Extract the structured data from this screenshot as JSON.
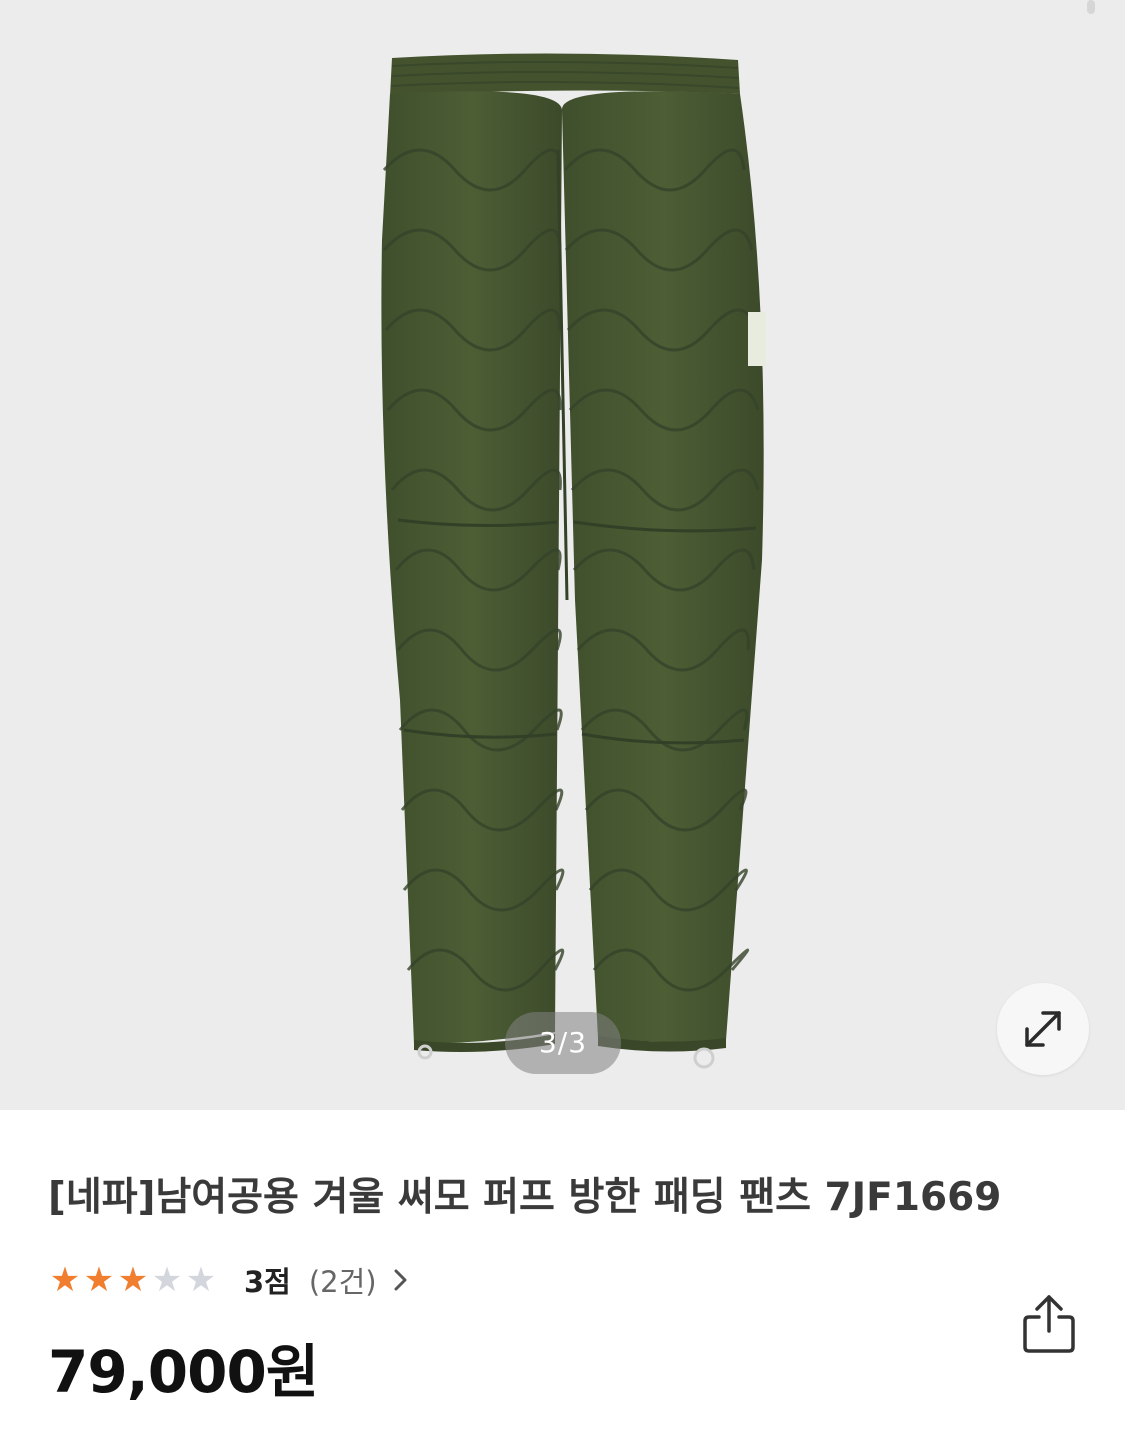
{
  "gallery": {
    "page_indicator": "3/3",
    "image_icon": "quilted-olive-pants-image",
    "expand_icon": "expand-arrows-icon",
    "background_color": "#ececec",
    "product_color": "#4a5a32"
  },
  "product": {
    "title": "[네파]남여공용 겨울 써모 퍼프 방한 패딩 팬츠 7JF1669",
    "rating": {
      "stars_filled": 3,
      "stars_total": 5,
      "score_label": "3점",
      "count_label": "(2건)",
      "star_color": "#f07e2e",
      "chevron_icon": "chevron-right-icon"
    },
    "price": "79,000원",
    "share_icon": "share-icon"
  }
}
